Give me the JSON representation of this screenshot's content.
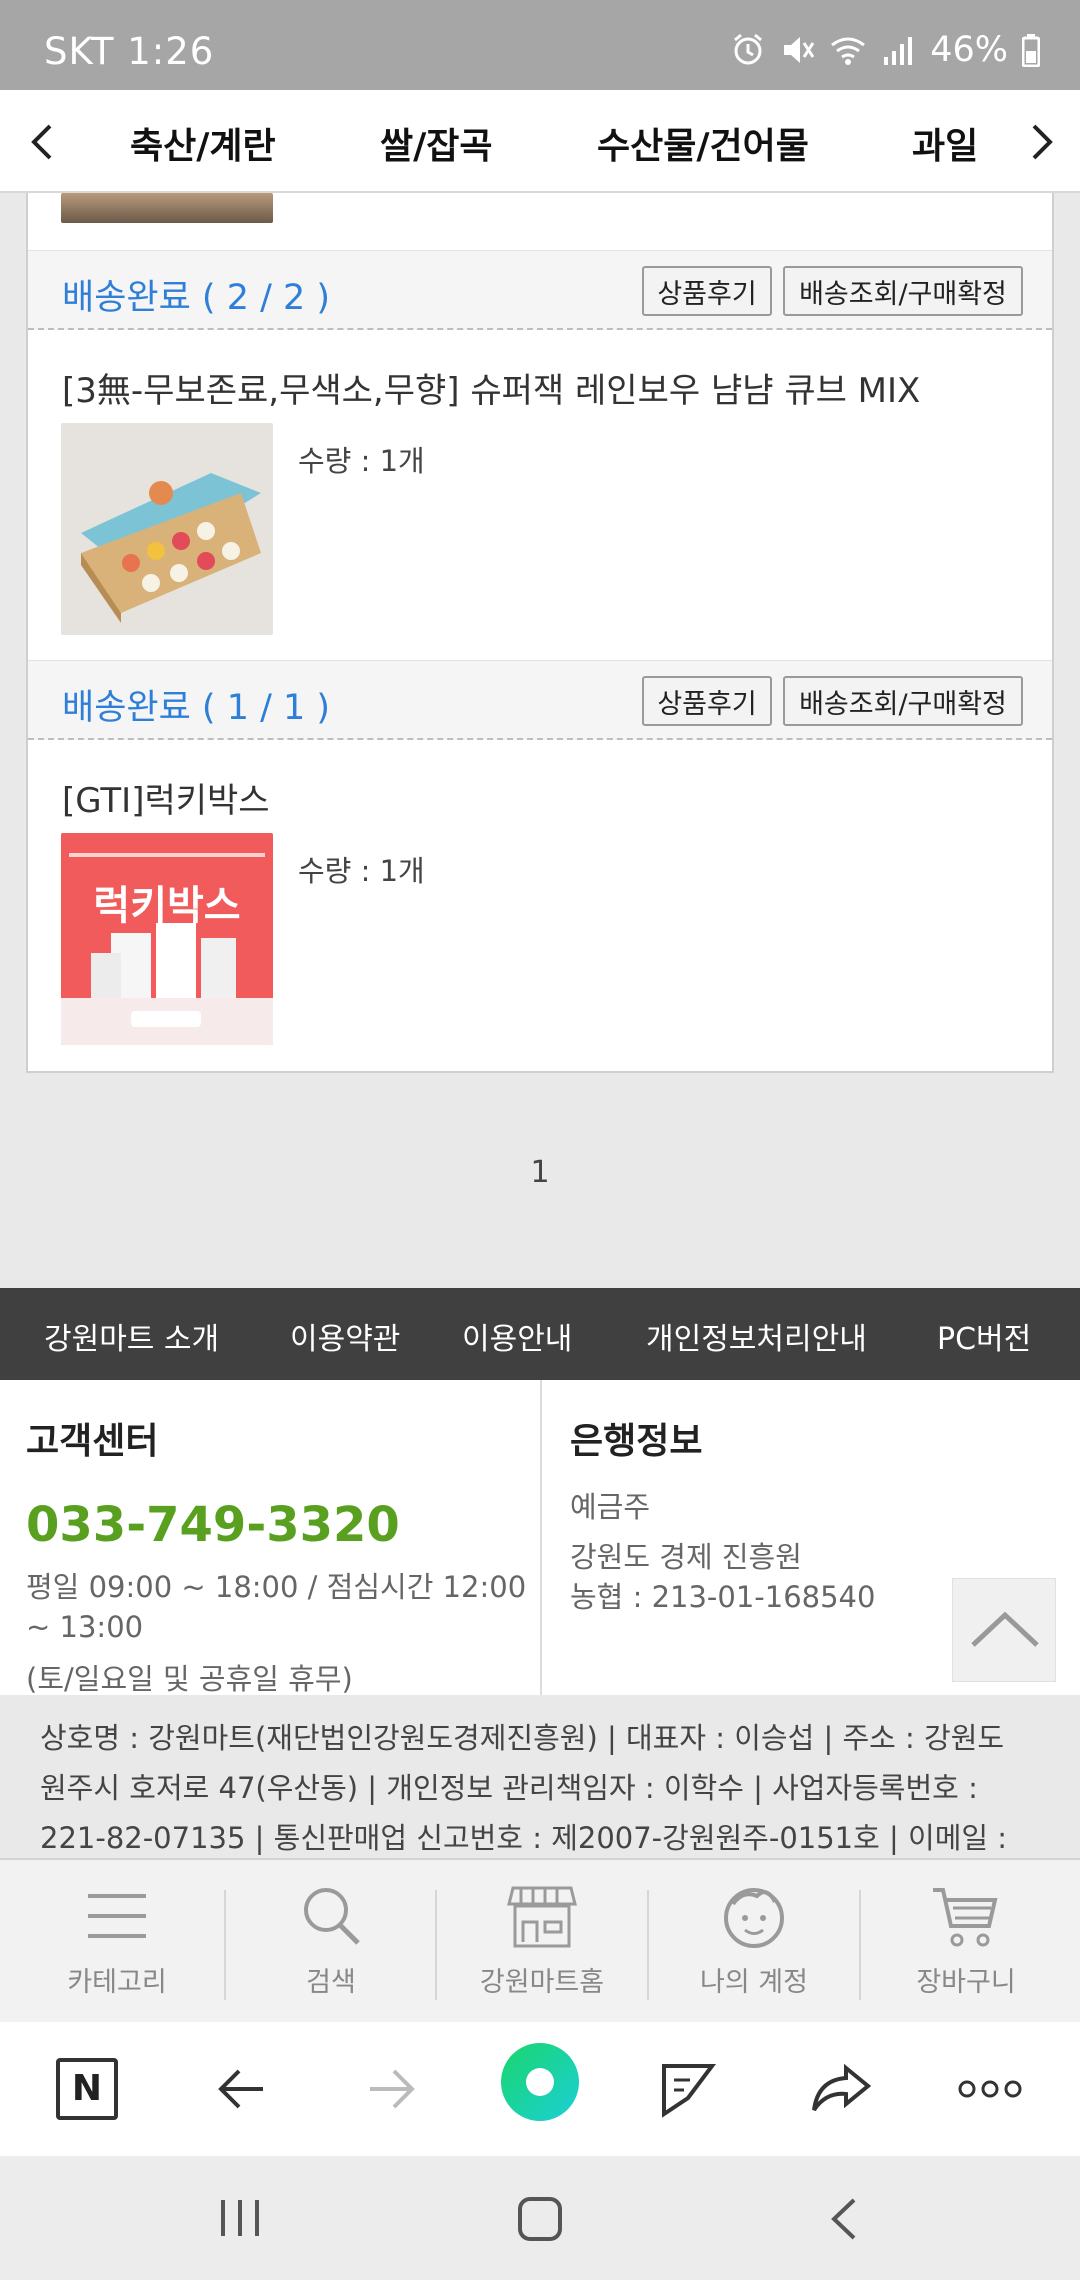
{
  "status_bar": {
    "carrier": "SKT 1:26",
    "battery": "46%"
  },
  "category_bar": {
    "items": [
      "축산/계란",
      "쌀/잡곡",
      "수산물/건어물",
      "과일"
    ]
  },
  "orders": [
    {
      "status": "배송완료 ( 2 / 2 )",
      "review_btn": "상품후기",
      "track_btn": "배송조회/구매확정",
      "product_name": "[3無-무보존료,무색소,무향] 슈퍼잭 레인보우 냠냠 큐브 MIX",
      "quantity": "수량 : 1개"
    },
    {
      "status": "배송완료 ( 1 / 1 )",
      "review_btn": "상품후기",
      "track_btn": "배송조회/구매확정",
      "product_name": "[GTI]럭키박스",
      "quantity": "수량 : 1개",
      "thumb_text": "럭키박스"
    }
  ],
  "pagination": {
    "current": "1"
  },
  "footer_nav": [
    "강원마트 소개",
    "이용약관",
    "이용안내",
    "개인정보처리안내",
    "PC버전"
  ],
  "customer_center": {
    "title": "고객센터",
    "phone": "033-749-3320",
    "hours_1": "평일 09:00 ~ 18:00 / 점심시간 12:00",
    "hours_2": "~ 13:00",
    "hours_3": "(토/일요일 및 공휴일 휴무)"
  },
  "bank_info": {
    "title": "은행정보",
    "holder_label": "예금주",
    "holder": "강원도 경제 진흥원",
    "account": "농협 : 213-01-168540"
  },
  "company_info": {
    "line_1": "상호명 : 강원마트(재단법인강원도경제진흥원) | 대표자 : 이승섭 | 주소 : 강원도",
    "line_2": "원주시 호저로 47(우산동) | 개인정보 관리책임자 : 이학수 | 사업자등록번호 :",
    "line_3": "221-82-07135 | 통신판매업 신고번호 : 제2007-강원원주-0151호 | 이메일 :"
  },
  "tab_bar": [
    {
      "label": "카테고리",
      "icon": "menu-icon"
    },
    {
      "label": "검색",
      "icon": "search-icon"
    },
    {
      "label": "강원마트홈",
      "icon": "store-icon"
    },
    {
      "label": "나의 계정",
      "icon": "face-icon"
    },
    {
      "label": "장바구니",
      "icon": "cart-icon"
    }
  ],
  "browser_bar": {
    "home_letter": "N"
  },
  "colors": {
    "accent_blue": "#2f7fd8",
    "phone_green": "#5aa020",
    "footer_dark": "#404040",
    "browser_green": "#1ed29a"
  }
}
